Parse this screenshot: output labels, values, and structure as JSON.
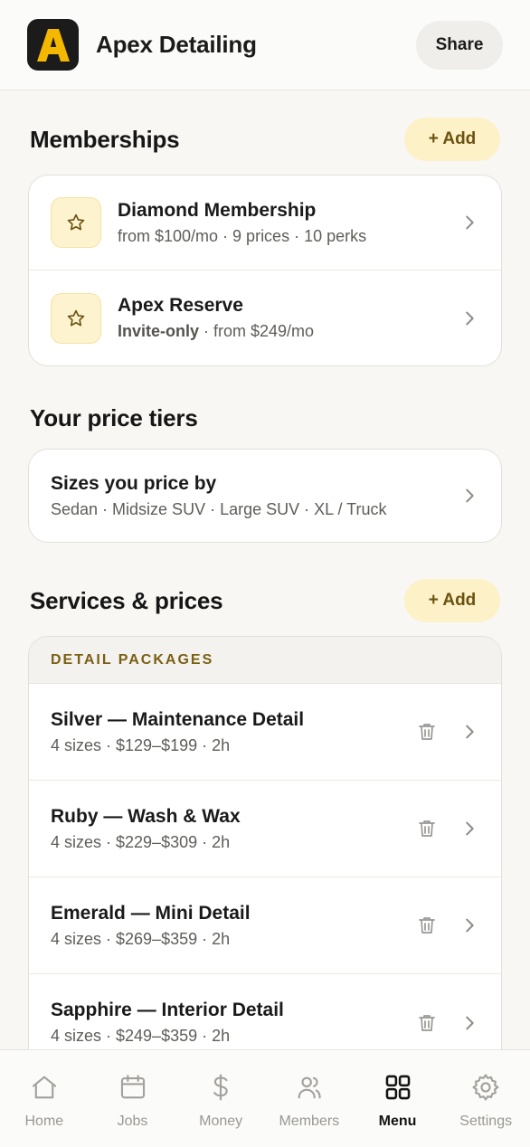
{
  "header": {
    "logo_letter": "A",
    "title": "Apex Detailing",
    "share_label": "Share"
  },
  "memberships": {
    "title": "Memberships",
    "add_label": "+ Add",
    "items": [
      {
        "name": "Diamond Membership",
        "meta": "from $100/mo · 9 prices · 10 perks",
        "icon": "star-icon"
      },
      {
        "name": "Apex Reserve",
        "badge": "Invite-only",
        "meta": " · from $249/mo",
        "icon": "star-icon"
      }
    ]
  },
  "price_tiers": {
    "title": "Your price tiers",
    "row_title": "Sizes you price by",
    "row_sub": "Sedan · Midsize SUV · Large SUV · XL / Truck"
  },
  "services": {
    "title": "Services & prices",
    "add_label": "+ Add",
    "category": "DETAIL PACKAGES",
    "items": [
      {
        "name": "Silver — Maintenance Detail",
        "meta": "4 sizes · $129–$199 · 2h"
      },
      {
        "name": "Ruby — Wash & Wax",
        "meta": "4 sizes · $229–$309 · 2h"
      },
      {
        "name": "Emerald — Mini Detail",
        "meta": "4 sizes · $269–$359 · 2h"
      },
      {
        "name": "Sapphire — Interior Detail",
        "meta": "4 sizes · $249–$359 · 2h"
      }
    ]
  },
  "tabs": [
    {
      "label": "Home",
      "icon": "home-icon",
      "active": false
    },
    {
      "label": "Jobs",
      "icon": "calendar-icon",
      "active": false
    },
    {
      "label": "Money",
      "icon": "dollar-icon",
      "active": false
    },
    {
      "label": "Members",
      "icon": "members-icon",
      "active": false
    },
    {
      "label": "Menu",
      "icon": "grid-icon",
      "active": true
    },
    {
      "label": "Settings",
      "icon": "gear-icon",
      "active": false
    }
  ],
  "colors": {
    "accent": "#f5b800",
    "accent_soft": "#fdf1c8",
    "accent_text": "#6b5210",
    "background": "#f8f7f4"
  }
}
